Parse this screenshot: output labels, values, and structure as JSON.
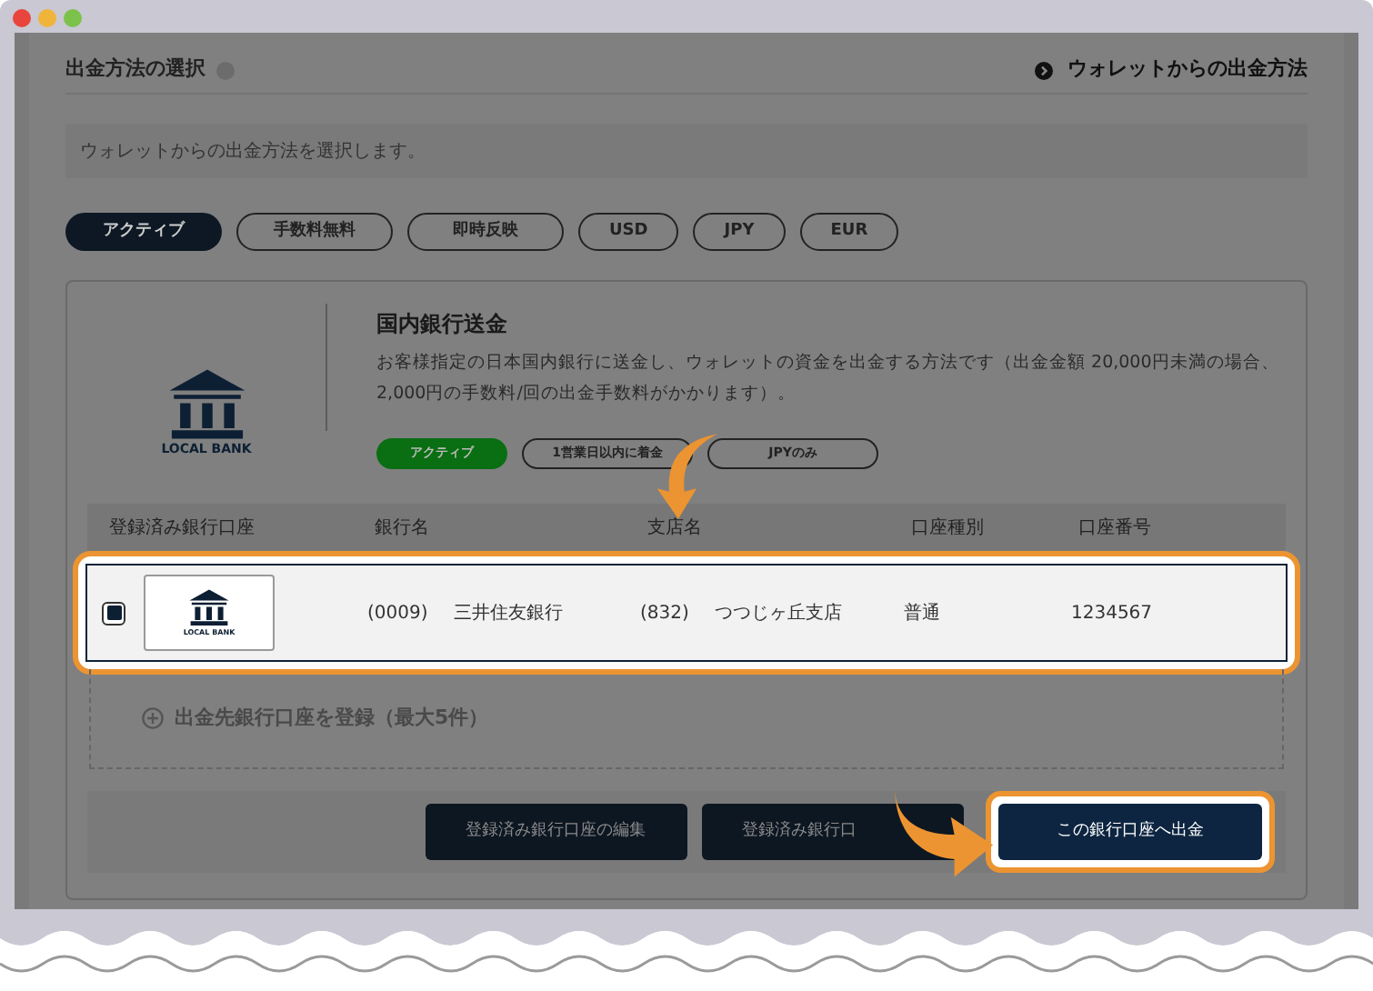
{
  "header": {
    "title": "出金方法の選択",
    "link": "ウォレットからの出金方法"
  },
  "info": "ウォレットからの出金方法を選択します。",
  "filters": [
    {
      "label": "アクティブ",
      "selected": true
    },
    {
      "label": "手数料無料",
      "selected": false
    },
    {
      "label": "即時反映",
      "selected": false
    },
    {
      "label": "USD",
      "selected": false
    },
    {
      "label": "JPY",
      "selected": false
    },
    {
      "label": "EUR",
      "selected": false
    }
  ],
  "method": {
    "logo_text": "LOCAL BANK",
    "title": "国内銀行送金",
    "description": "お客様指定の日本国内銀行に送金し、ウォレットの資金を出金する方法です（出金金額 20,000円未満の場合、2,000円の手数料/回の出金手数料がかかります）。",
    "tags": [
      {
        "label": "アクティブ",
        "kind": "status"
      },
      {
        "label": "1営業日以内に着金",
        "kind": "feature"
      },
      {
        "label": "JPYのみ",
        "kind": "feature"
      }
    ]
  },
  "table": {
    "columns": [
      "登録済み銀行口座",
      "銀行名",
      "支店名",
      "口座種別",
      "口座番号"
    ],
    "rows": [
      {
        "highlighted": true,
        "checked": true,
        "logo_text": "LOCAL BANK",
        "bank_code": "(0009)",
        "bank_name": "三井住友銀行",
        "branch_code": "(832)",
        "branch_name": "つつじヶ丘支店",
        "type": "普通",
        "number": "1234567"
      }
    ]
  },
  "add_account": "出金先銀行口座を登録（最大5件）",
  "buttons": [
    {
      "label": "登録済み銀行口座の編集",
      "highlighted": false
    },
    {
      "label": "登録済み銀行口",
      "highlighted": false
    },
    {
      "label": "この銀行口座へ出金",
      "highlighted": true
    }
  ]
}
